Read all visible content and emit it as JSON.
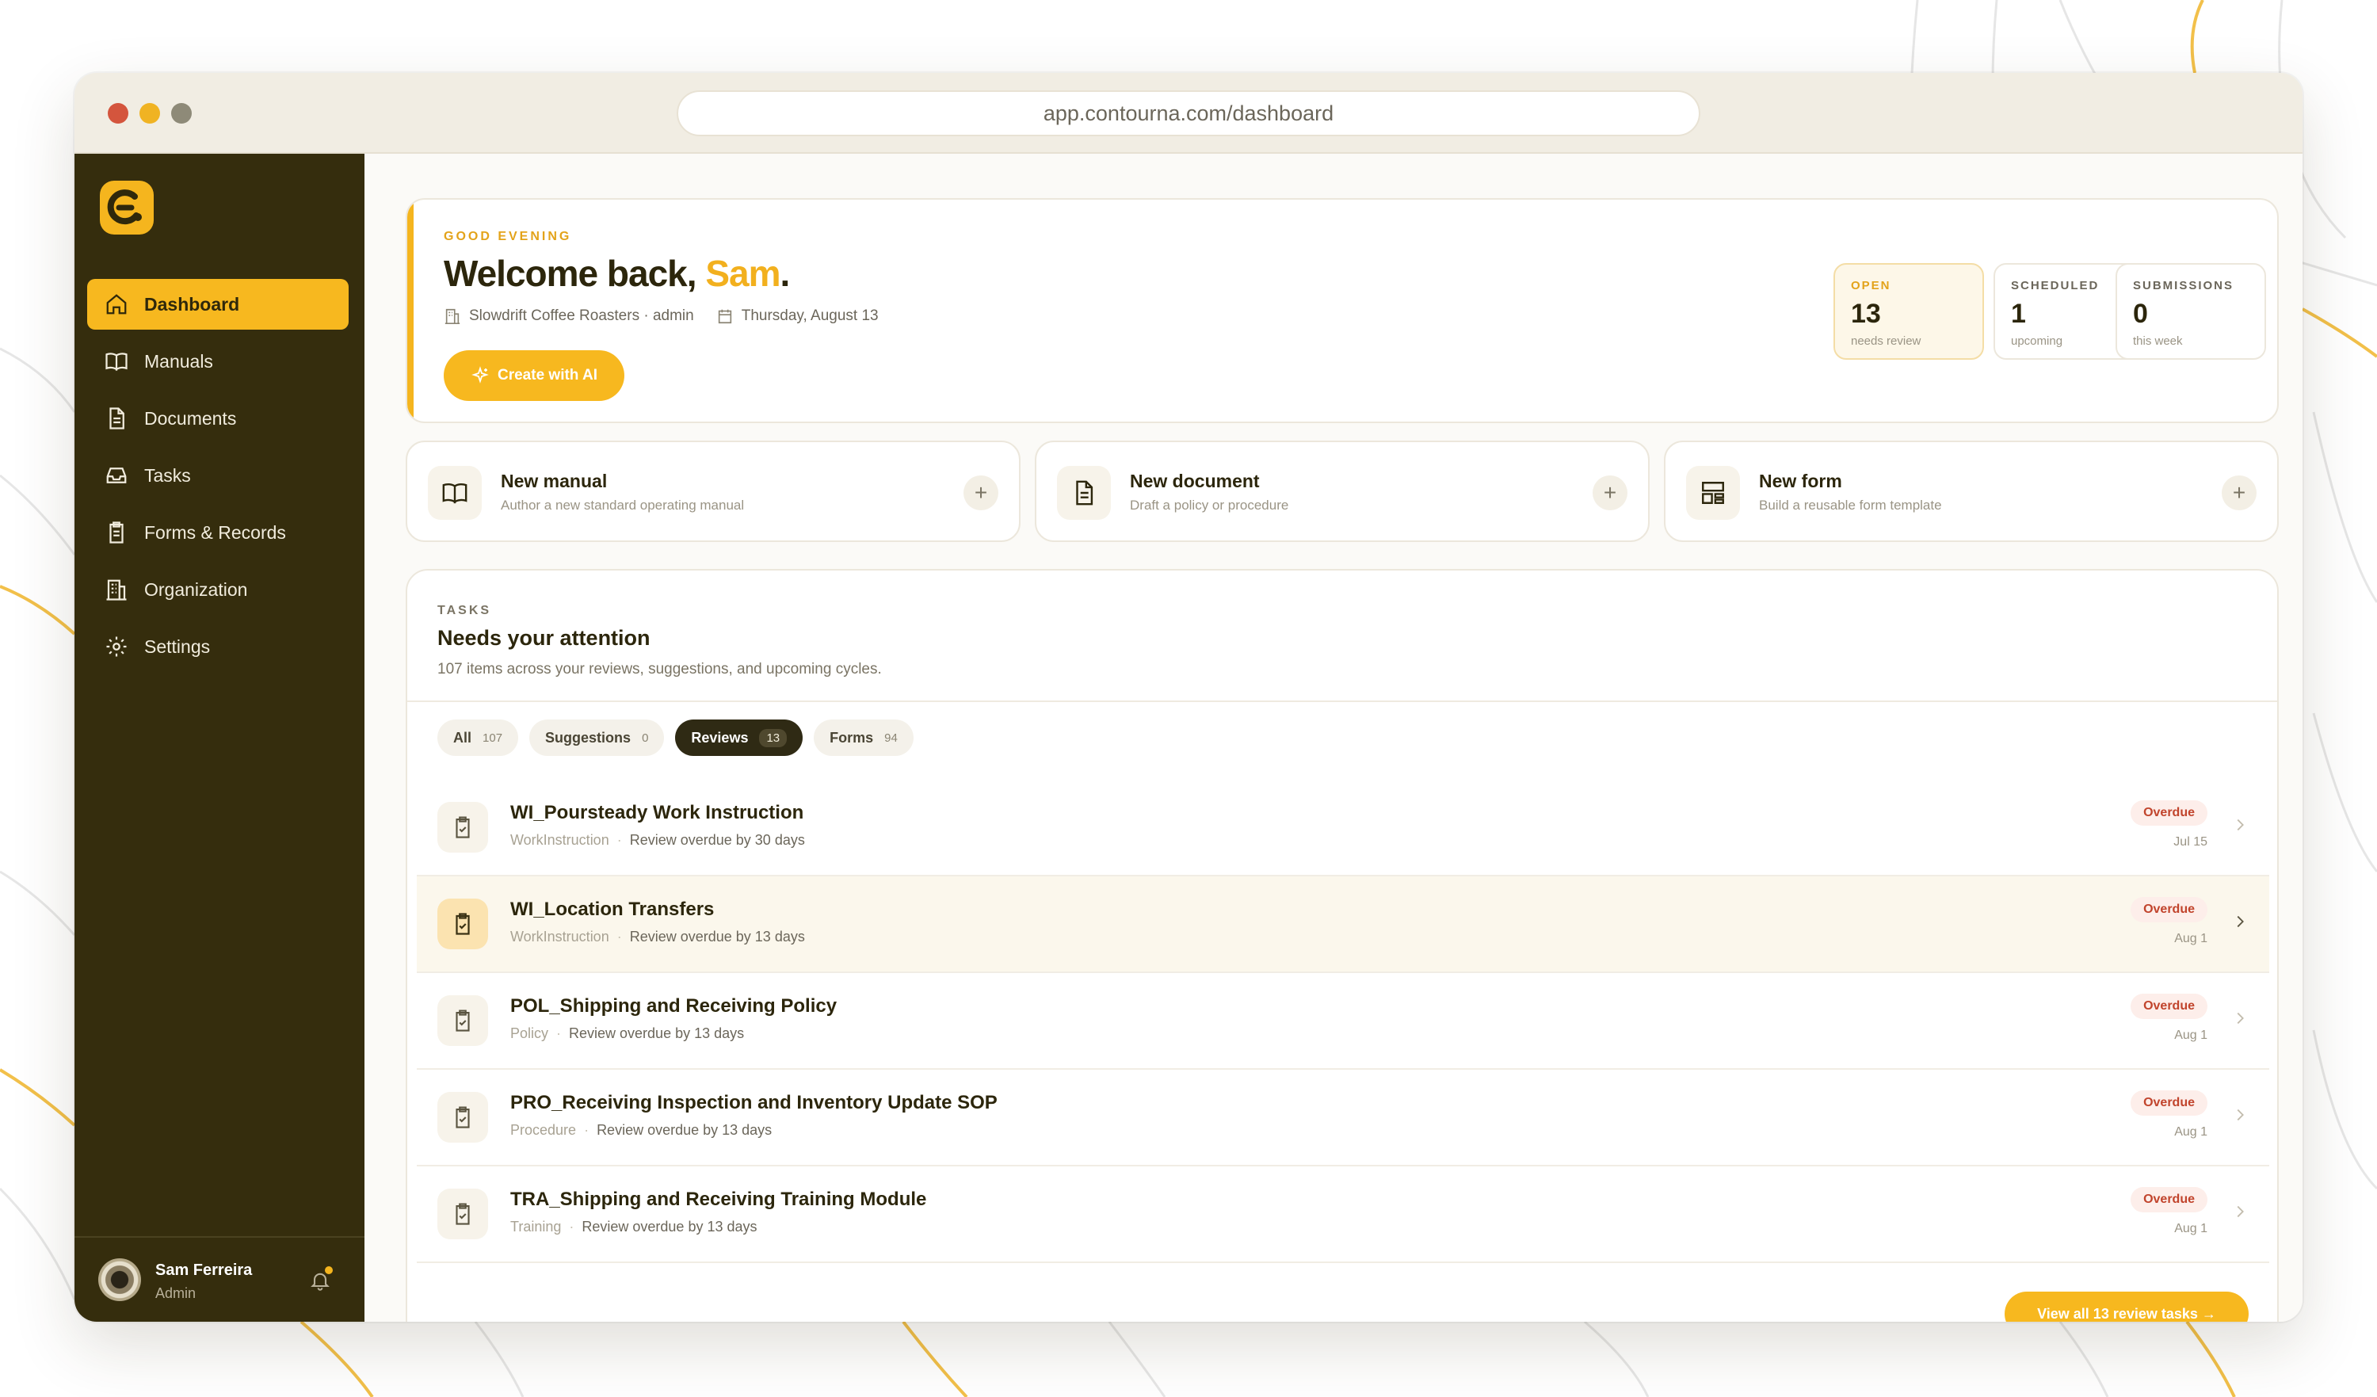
{
  "browser": {
    "url": "app.contourna.com/dashboard"
  },
  "sidebar": {
    "items": [
      {
        "label": "Dashboard",
        "icon": "home-icon",
        "active": true
      },
      {
        "label": "Manuals",
        "icon": "book-icon"
      },
      {
        "label": "Documents",
        "icon": "document-icon"
      },
      {
        "label": "Tasks",
        "icon": "inbox-icon"
      },
      {
        "label": "Forms & Records",
        "icon": "clipboard-icon"
      },
      {
        "label": "Organization",
        "icon": "building-icon"
      },
      {
        "label": "Settings",
        "icon": "gear-icon"
      }
    ],
    "user": {
      "name": "Sam Ferreira",
      "role": "Admin"
    }
  },
  "welcome": {
    "greeting": "GOOD EVENING",
    "title_prefix": "Welcome back, ",
    "title_name": "Sam",
    "title_suffix": ".",
    "org": "Slowdrift Coffee Roasters · admin",
    "date": "Thursday, August 13",
    "cta": "Create with AI"
  },
  "stats": [
    {
      "label": "OPEN",
      "value": "13",
      "sub": "needs review"
    },
    {
      "label": "SCHEDULED",
      "value": "1",
      "sub": "upcoming"
    },
    {
      "label": "SUBMISSIONS",
      "value": "0",
      "sub": "this week"
    }
  ],
  "quick_actions": [
    {
      "title": "New manual",
      "subtitle": "Author a new standard operating manual",
      "icon": "book-icon"
    },
    {
      "title": "New document",
      "subtitle": "Draft a policy or procedure",
      "icon": "document-icon"
    },
    {
      "title": "New form",
      "subtitle": "Build a reusable form template",
      "icon": "form-layout-icon"
    }
  ],
  "tasks": {
    "eyebrow": "TASKS",
    "title": "Needs your attention",
    "subtitle": "107 items across your reviews, suggestions, and upcoming cycles.",
    "filters": [
      {
        "label": "All",
        "count": "107"
      },
      {
        "label": "Suggestions",
        "count": "0"
      },
      {
        "label": "Reviews",
        "count": "13",
        "active": true
      },
      {
        "label": "Forms",
        "count": "94"
      }
    ],
    "items": [
      {
        "title": "WI_Poursteady Work Instruction",
        "type": "WorkInstruction",
        "detail": "Review overdue by 30 days",
        "status": "Overdue",
        "date": "Jul 15"
      },
      {
        "title": "WI_Location Transfers",
        "type": "WorkInstruction",
        "detail": "Review overdue by 13 days",
        "status": "Overdue",
        "date": "Aug 1"
      },
      {
        "title": "POL_Shipping and Receiving Policy",
        "type": "Policy",
        "detail": "Review overdue by 13 days",
        "status": "Overdue",
        "date": "Aug 1"
      },
      {
        "title": "PRO_Receiving Inspection and Inventory Update SOP",
        "type": "Procedure",
        "detail": "Review overdue by 13 days",
        "status": "Overdue",
        "date": "Aug 1"
      },
      {
        "title": "TRA_Shipping and Receiving Training Module",
        "type": "Training",
        "detail": "Review overdue by 13 days",
        "status": "Overdue",
        "date": "Aug 1"
      }
    ],
    "view_all": "View all 13 review tasks →"
  },
  "colors": {
    "accent": "#f7b81f",
    "sidebar": "#352d0d",
    "overdue": "#c1442c"
  }
}
